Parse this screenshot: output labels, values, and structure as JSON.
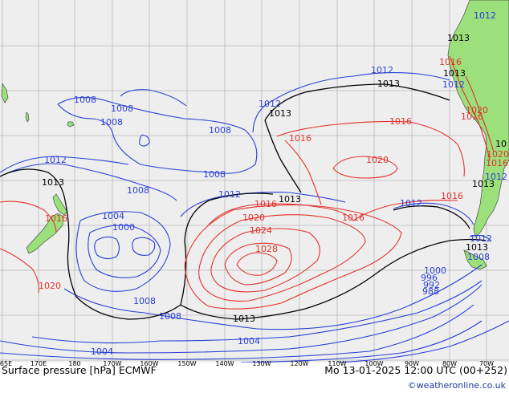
{
  "map": {
    "title": "Surface pressure [hPa] ECMWF",
    "run_info": "Mo 13-01-2025 12:00 UTC (00+252)",
    "credit": "©weatheronline.co.uk",
    "colors": {
      "ocean": "#eeeeee",
      "land": "#9be07a",
      "low_isobar": "#2a3fd6",
      "high_isobar": "#e2322c",
      "mean_isobar": "#000000",
      "grid": "#b9b9b9"
    },
    "longitude_labels": [
      "165E",
      "170E",
      "180",
      "170W",
      "160W",
      "150W",
      "140W",
      "130W",
      "120W",
      "110W",
      "100W",
      "90W",
      "80W",
      "70W"
    ],
    "contour_labels": [
      {
        "text": "1008",
        "color": "low"
      },
      {
        "text": "1008",
        "color": "low"
      },
      {
        "text": "1008",
        "color": "low"
      },
      {
        "text": "1008",
        "color": "low"
      },
      {
        "text": "1008",
        "color": "low"
      },
      {
        "text": "1008",
        "color": "low"
      },
      {
        "text": "1008",
        "color": "low"
      },
      {
        "text": "1008",
        "color": "low"
      },
      {
        "text": "1008",
        "color": "low"
      },
      {
        "text": "1012",
        "color": "low"
      },
      {
        "text": "1012",
        "color": "low"
      },
      {
        "text": "1012",
        "color": "low"
      },
      {
        "text": "1012",
        "color": "low"
      },
      {
        "text": "1012",
        "color": "low"
      },
      {
        "text": "1012",
        "color": "low"
      },
      {
        "text": "1012",
        "color": "low"
      },
      {
        "text": "1012",
        "color": "low"
      },
      {
        "text": "1012",
        "color": "low"
      },
      {
        "text": "1004",
        "color": "low"
      },
      {
        "text": "1004",
        "color": "low"
      },
      {
        "text": "1004",
        "color": "low"
      },
      {
        "text": "1000",
        "color": "low"
      },
      {
        "text": "1000",
        "color": "low"
      },
      {
        "text": "996",
        "color": "low"
      },
      {
        "text": "992",
        "color": "low"
      },
      {
        "text": "988",
        "color": "low"
      },
      {
        "text": "1013",
        "color": "mean"
      },
      {
        "text": "1013",
        "color": "mean"
      },
      {
        "text": "1013",
        "color": "mean"
      },
      {
        "text": "1013",
        "color": "mean"
      },
      {
        "text": "1013",
        "color": "mean"
      },
      {
        "text": "1013",
        "color": "mean"
      },
      {
        "text": "1013",
        "color": "mean"
      },
      {
        "text": "1013",
        "color": "mean"
      },
      {
        "text": "1013",
        "color": "mean"
      },
      {
        "text": "1016",
        "color": "high"
      },
      {
        "text": "1016",
        "color": "high"
      },
      {
        "text": "1016",
        "color": "high"
      },
      {
        "text": "1016",
        "color": "high"
      },
      {
        "text": "1016",
        "color": "high"
      },
      {
        "text": "1016",
        "color": "high"
      },
      {
        "text": "1016",
        "color": "high"
      },
      {
        "text": "1016",
        "color": "high"
      },
      {
        "text": "1016",
        "color": "high"
      },
      {
        "text": "1020",
        "color": "high"
      },
      {
        "text": "1020",
        "color": "high"
      },
      {
        "text": "1020",
        "color": "high"
      },
      {
        "text": "1020",
        "color": "high"
      },
      {
        "text": "1020",
        "color": "high"
      },
      {
        "text": "1024",
        "color": "high"
      },
      {
        "text": "1028",
        "color": "high"
      },
      {
        "text": "10",
        "color": "mean"
      }
    ]
  }
}
